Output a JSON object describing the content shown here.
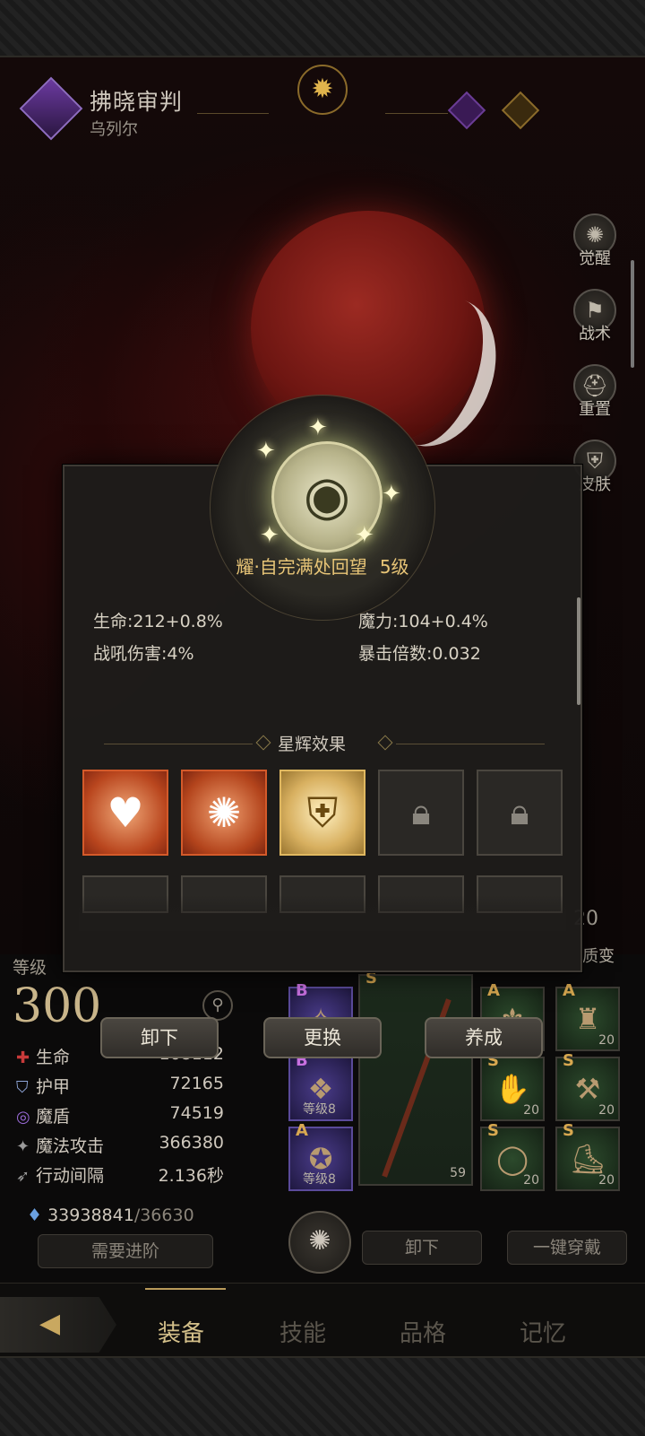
{
  "header": {
    "title": "拂晓审判",
    "subtitle": "乌列尔"
  },
  "side_menu": [
    {
      "label": "觉醒",
      "icon": "sun-icon"
    },
    {
      "label": "战术",
      "icon": "banner-icon"
    },
    {
      "label": "重置",
      "icon": "helmet-icon"
    },
    {
      "label": "皮肤",
      "icon": "armor-icon"
    }
  ],
  "popup": {
    "title": "耀·自完满处回望",
    "level": "5级",
    "stats": {
      "hp": "生命:212+0.8%",
      "mana": "魔力:104+0.4%",
      "warcry": "战吼伤害:4%",
      "crit": "暴击倍数:0.032"
    },
    "section_title": "星辉效果",
    "effects_row1": [
      {
        "icon": "heart-cross-icon",
        "state": "unlocked"
      },
      {
        "icon": "flame-burst-icon",
        "state": "unlocked"
      },
      {
        "icon": "spiral-shield-icon",
        "state": "unlocked"
      },
      {
        "icon": "lock-icon",
        "state": "locked"
      },
      {
        "icon": "lock-icon",
        "state": "locked"
      }
    ]
  },
  "transform_badge": {
    "count": "20",
    "label": "质变"
  },
  "character": {
    "level_label": "等级",
    "level_value": "300",
    "attributes": [
      {
        "name": "生命",
        "value": "168112",
        "icon": "hp-icon"
      },
      {
        "name": "护甲",
        "value": "72165",
        "icon": "armor-shield-icon"
      },
      {
        "name": "魔盾",
        "value": "74519",
        "icon": "magic-shield-icon"
      },
      {
        "name": "魔法攻击",
        "value": "366380",
        "icon": "magic-attack-icon"
      },
      {
        "name": "行动间隔",
        "value": "2.136秒",
        "icon": "speed-icon"
      }
    ],
    "gold": "33938841",
    "gold_max": "/36630",
    "need_advance": "需要进阶"
  },
  "actions": {
    "unequip": "卸下",
    "replace": "更换",
    "cultivate": "养成",
    "unequip2": "卸下",
    "equip_all": "一键穿戴"
  },
  "equipment": {
    "runes": [
      {
        "grade": "B",
        "label": ""
      },
      {
        "grade": "B",
        "label": "等级8"
      },
      {
        "grade": "A",
        "label": "等级8"
      }
    ],
    "weapon": {
      "grade": "S",
      "num": "59"
    },
    "gear": [
      {
        "grade": "A",
        "num": ""
      },
      {
        "grade": "A",
        "num": "20"
      },
      {
        "grade": "S",
        "num": "20"
      },
      {
        "grade": "S",
        "num": "20"
      },
      {
        "grade": "S",
        "num": "20"
      },
      {
        "grade": "S",
        "num": "20"
      }
    ]
  },
  "tabs": [
    "装备",
    "技能",
    "品格",
    "记忆"
  ]
}
